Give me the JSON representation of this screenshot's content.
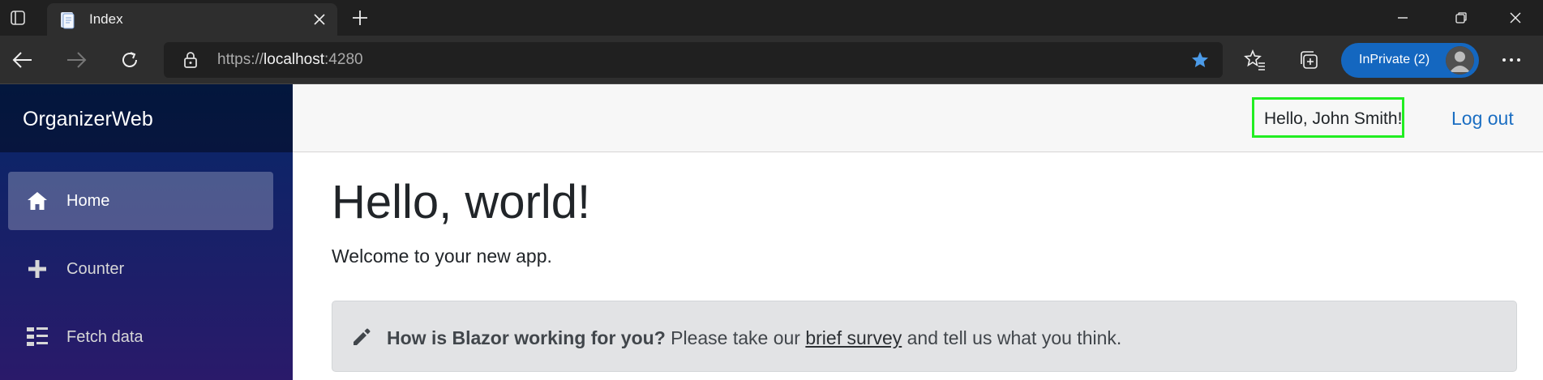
{
  "browser": {
    "tab": {
      "title": "Index"
    },
    "address": {
      "scheme": "https://",
      "host": "localhost",
      "port": ":4280"
    },
    "profile": {
      "label": "InPrivate (2)"
    },
    "accent_color": "#1467c0",
    "icons": [
      "tab-actions-icon",
      "page-favicon-icon",
      "close-tab-icon",
      "new-tab-icon",
      "minimize-icon",
      "restore-icon",
      "close-window-icon",
      "back-icon",
      "forward-icon",
      "refresh-icon",
      "lock-icon",
      "favorite-star-icon",
      "favorites-icon",
      "collections-icon",
      "avatar",
      "more-icon"
    ]
  },
  "app": {
    "brand": "OrganizerWeb",
    "nav": [
      {
        "label": "Home",
        "icon": "home-icon",
        "active": true
      },
      {
        "label": "Counter",
        "icon": "plus-icon",
        "active": false
      },
      {
        "label": "Fetch data",
        "icon": "list-icon",
        "active": false
      }
    ],
    "top_row": {
      "greeting": "Hello, John Smith!",
      "logout": "Log out"
    },
    "main": {
      "heading": "Hello, world!",
      "welcome": "Welcome to your new app.",
      "survey": {
        "question": "How is Blazor working for you?",
        "pre_link": "Please take our",
        "link": "brief survey",
        "post_link": "and tell us what you think."
      }
    },
    "colors": {
      "sidebar_top": "#052767",
      "sidebar_bottom": "#2a1a6a",
      "link": "#1b6ec2",
      "highlight_box": "#22ee22"
    }
  }
}
